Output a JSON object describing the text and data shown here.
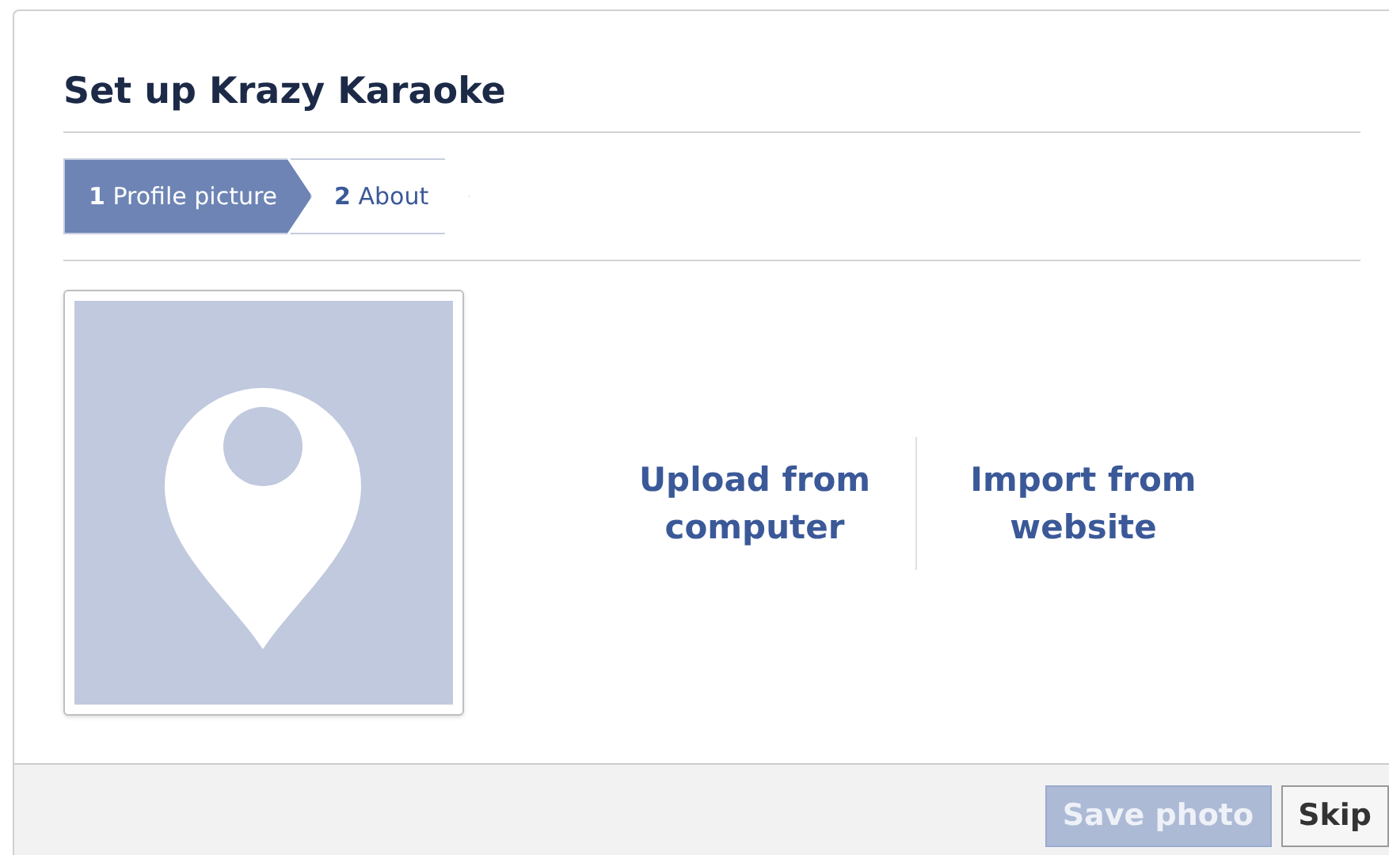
{
  "dialog": {
    "title": "Set up Krazy Karaoke"
  },
  "steps": [
    {
      "number": "1",
      "label": "Profile picture",
      "selected": true
    },
    {
      "number": "2",
      "label": "About",
      "selected": false
    }
  ],
  "photo_options": [
    {
      "label": "Upload from computer"
    },
    {
      "label": "Import from website"
    }
  ],
  "buttons": [
    {
      "label": "Save photo",
      "kind": "primary",
      "disabled": true
    },
    {
      "label": "Skip",
      "kind": "secondary",
      "disabled": false
    }
  ]
}
